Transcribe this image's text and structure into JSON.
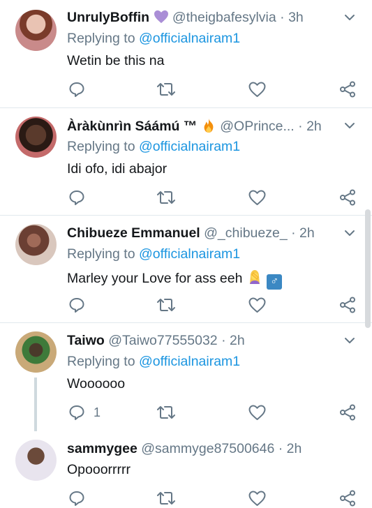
{
  "colors": {
    "accent": "#1b95e0",
    "muted": "#657786",
    "text": "#14171a",
    "divider": "#e1e8ed"
  },
  "tweets": [
    {
      "name": "UnrulyBoffin",
      "name_emoji": "purple-heart",
      "handle": "@theigbafesylvia",
      "time": "3h",
      "replying_prefix": "Replying to",
      "replying_to": "@officialnairam1",
      "text": "Wetin be this na",
      "reply_count": ""
    },
    {
      "name": "Àràkùnrìn Sáámú ™",
      "name_emoji": "fire",
      "handle": "@OPrince...",
      "time": "2h",
      "replying_prefix": "Replying to",
      "replying_to": "@officialnairam1",
      "text": "Idi ofo,  idi abajor",
      "reply_count": ""
    },
    {
      "name": "Chibueze Emmanuel",
      "handle": "@_chibueze_",
      "time": "2h",
      "replying_prefix": "Replying to",
      "replying_to": "@officialnairam1",
      "text": "Marley your Love for ass eeh",
      "text_emoji": [
        "woman-facepalming",
        "male-sign"
      ],
      "reply_count": ""
    },
    {
      "name": "Taiwo",
      "handle": "@Taiwo77555032",
      "time": "2h",
      "replying_prefix": "Replying to",
      "replying_to": "@officialnairam1",
      "text": "Woooooo",
      "reply_count": "1"
    },
    {
      "name": "sammygee",
      "handle": "@sammyge87500646",
      "time": "2h",
      "text": "Opooorrrrr",
      "reply_count": ""
    }
  ],
  "separator": "·",
  "male_sign": "♂"
}
